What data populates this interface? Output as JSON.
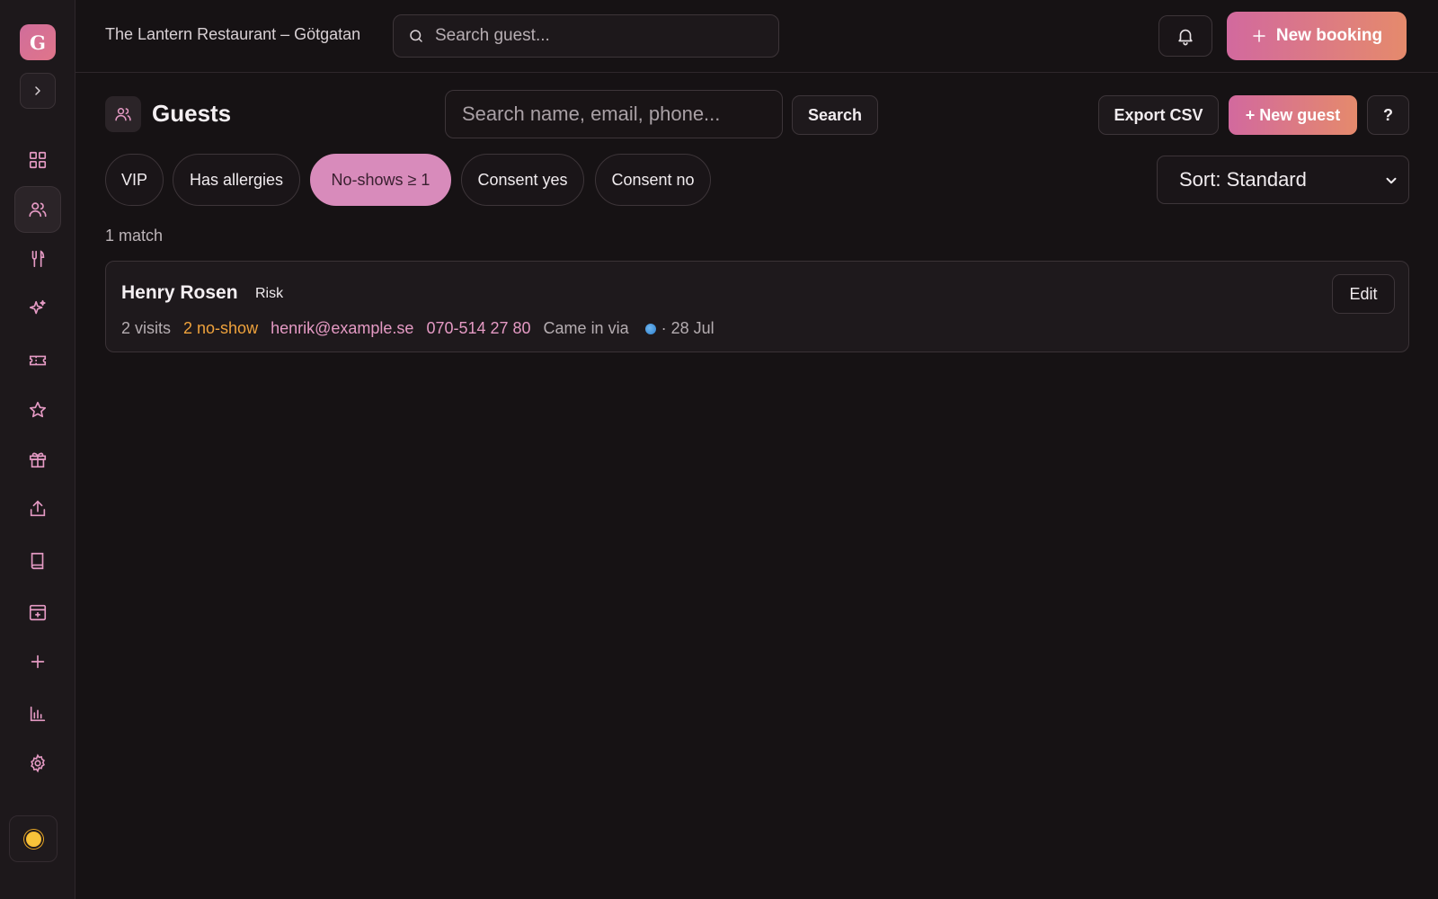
{
  "sidebar": {
    "logo_letter": "G",
    "nav": [
      {
        "icon": "dashboard-icon",
        "active": false
      },
      {
        "icon": "guests-icon",
        "active": true
      },
      {
        "icon": "cutlery-icon",
        "active": false
      },
      {
        "icon": "sparkle-icon",
        "active": false
      },
      {
        "icon": "ticket-icon",
        "active": false
      },
      {
        "icon": "star-icon",
        "active": false
      },
      {
        "icon": "gift-icon",
        "active": false
      },
      {
        "icon": "share-icon",
        "active": false
      },
      {
        "icon": "book-icon",
        "active": false
      },
      {
        "icon": "calendar-add-icon",
        "active": false
      },
      {
        "icon": "plus-icon",
        "active": false
      },
      {
        "icon": "bar-chart-icon",
        "active": false
      },
      {
        "icon": "gear-icon",
        "active": false
      }
    ]
  },
  "topbar": {
    "restaurant_name": "The Lantern Restaurant – Götgatan",
    "search_placeholder": "Search guest...",
    "new_booking_label": "New booking"
  },
  "page": {
    "title": "Guests",
    "search_placeholder": "Search name, email, phone...",
    "search_button": "Search",
    "export_label": "Export CSV",
    "new_guest_label": "+ New guest",
    "help_label": "?"
  },
  "filters": {
    "chips": [
      {
        "label": "VIP",
        "active": false
      },
      {
        "label": "Has allergies",
        "active": false
      },
      {
        "label": "No-shows ≥ 1",
        "active": true
      },
      {
        "label": "Consent yes",
        "active": false
      },
      {
        "label": "Consent no",
        "active": false
      }
    ],
    "sort_value": "Sort: Standard"
  },
  "results": {
    "count_label": "1 match",
    "guests": [
      {
        "name": "Henry Rosen",
        "badge": "Risk",
        "visits": "2 visits",
        "no_shows": "2 no-show",
        "email": "henrik@example.se",
        "phone": "070-514 27 80",
        "came_in_via": "Came in via",
        "date": "· 28 Jul",
        "edit_label": "Edit"
      }
    ]
  },
  "colors": {
    "accent_gradient_start": "#d2699e",
    "accent_gradient_end": "#e58a6c",
    "active_chip": "#d88bbb",
    "warning": "#efa23c",
    "link_pink": "#e59ac4"
  }
}
